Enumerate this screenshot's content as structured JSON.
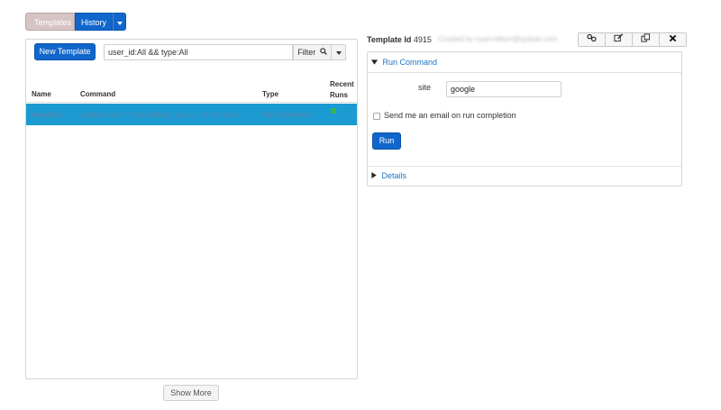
{
  "nav": {
    "templates_label": "Templates",
    "history_label": "History"
  },
  "toolbar": {
    "new_template_label": "New Template",
    "search_value": "user_id:All && type:All",
    "filter_label": "Filter"
  },
  "table": {
    "columns": [
      "Name",
      "Command",
      "Type",
      "Recent Runs"
    ],
    "rows": [
      {
        "name": "template1",
        "command": "explain select * from default_qubole_memetracker li",
        "type": "HiveCommand",
        "recent_run_status": "success"
      }
    ]
  },
  "show_more_label": "Show More",
  "detail": {
    "template_id_label": "Template Id",
    "template_id": "4915",
    "created_by": "Created by hyan+blkert@qubole.com",
    "run_command_label": "Run Command",
    "param_label": "site",
    "param_value": "google",
    "email_label": "Send me an email on run completion",
    "run_label": "Run",
    "details_label": "Details"
  },
  "actions": [
    "link-icon",
    "edit-icon",
    "clone-icon",
    "delete-icon"
  ],
  "colors": {
    "primary": "#1166cc",
    "selected_row": "#1b9bd1",
    "link": "#1a74c8",
    "success": "#3ab54a"
  }
}
